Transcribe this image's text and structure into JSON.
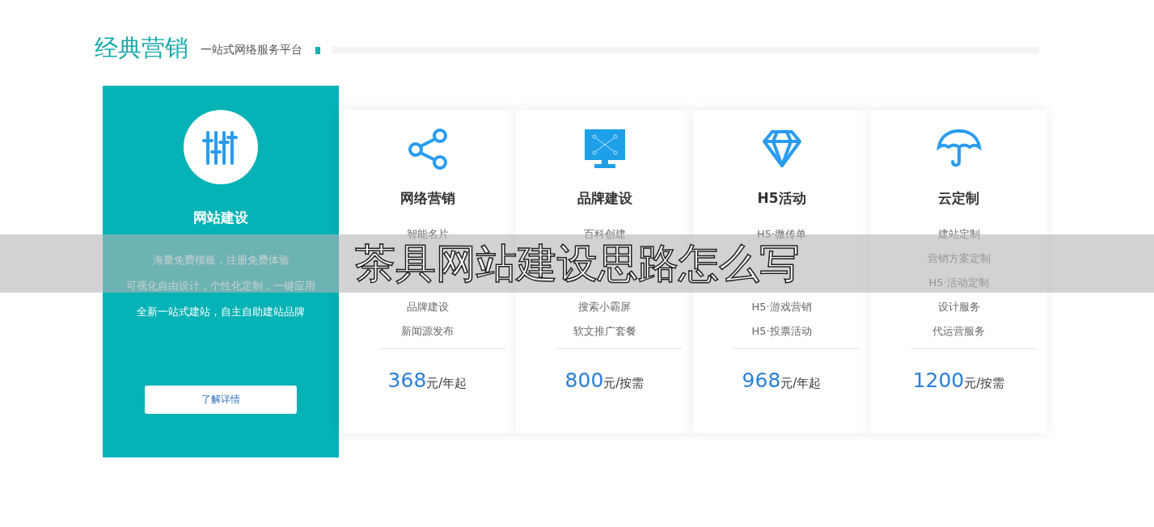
{
  "header": {
    "title": "经典营销",
    "subtitle": "一站式网络服务平台"
  },
  "featured": {
    "title": "网站建设",
    "lines": [
      "海量免费模板，注册免费体验",
      "可视化自由设计，个性化定制，一键应用",
      "全新一站式建站，自主自助建站品牌"
    ],
    "button": "了解详情"
  },
  "cards": [
    {
      "title": "网络营销",
      "items": [
        "智能名片"
      ],
      "items_below": [
        "品牌建设",
        "新闻源发布"
      ],
      "price": "368",
      "unit": "元/年起"
    },
    {
      "title": "品牌建设",
      "items": [
        "百科创建"
      ],
      "items_below": [
        "搜索小霸屏",
        "软文推广套餐"
      ],
      "price": "800",
      "unit": "元/按需"
    },
    {
      "title": "H5活动",
      "items": [
        "H5·微传单"
      ],
      "items_below": [
        "H5·游戏营销",
        "H5·投票活动"
      ],
      "price": "968",
      "unit": "元/年起"
    },
    {
      "title": "云定制",
      "items": [
        "建站定制",
        "营销方案定制",
        "H5·活动定制",
        "设计服务",
        "代运营服务"
      ],
      "price": "1200",
      "unit": "元/按需"
    }
  ],
  "banner": {
    "text": "茶具网站建设思路怎么写"
  }
}
